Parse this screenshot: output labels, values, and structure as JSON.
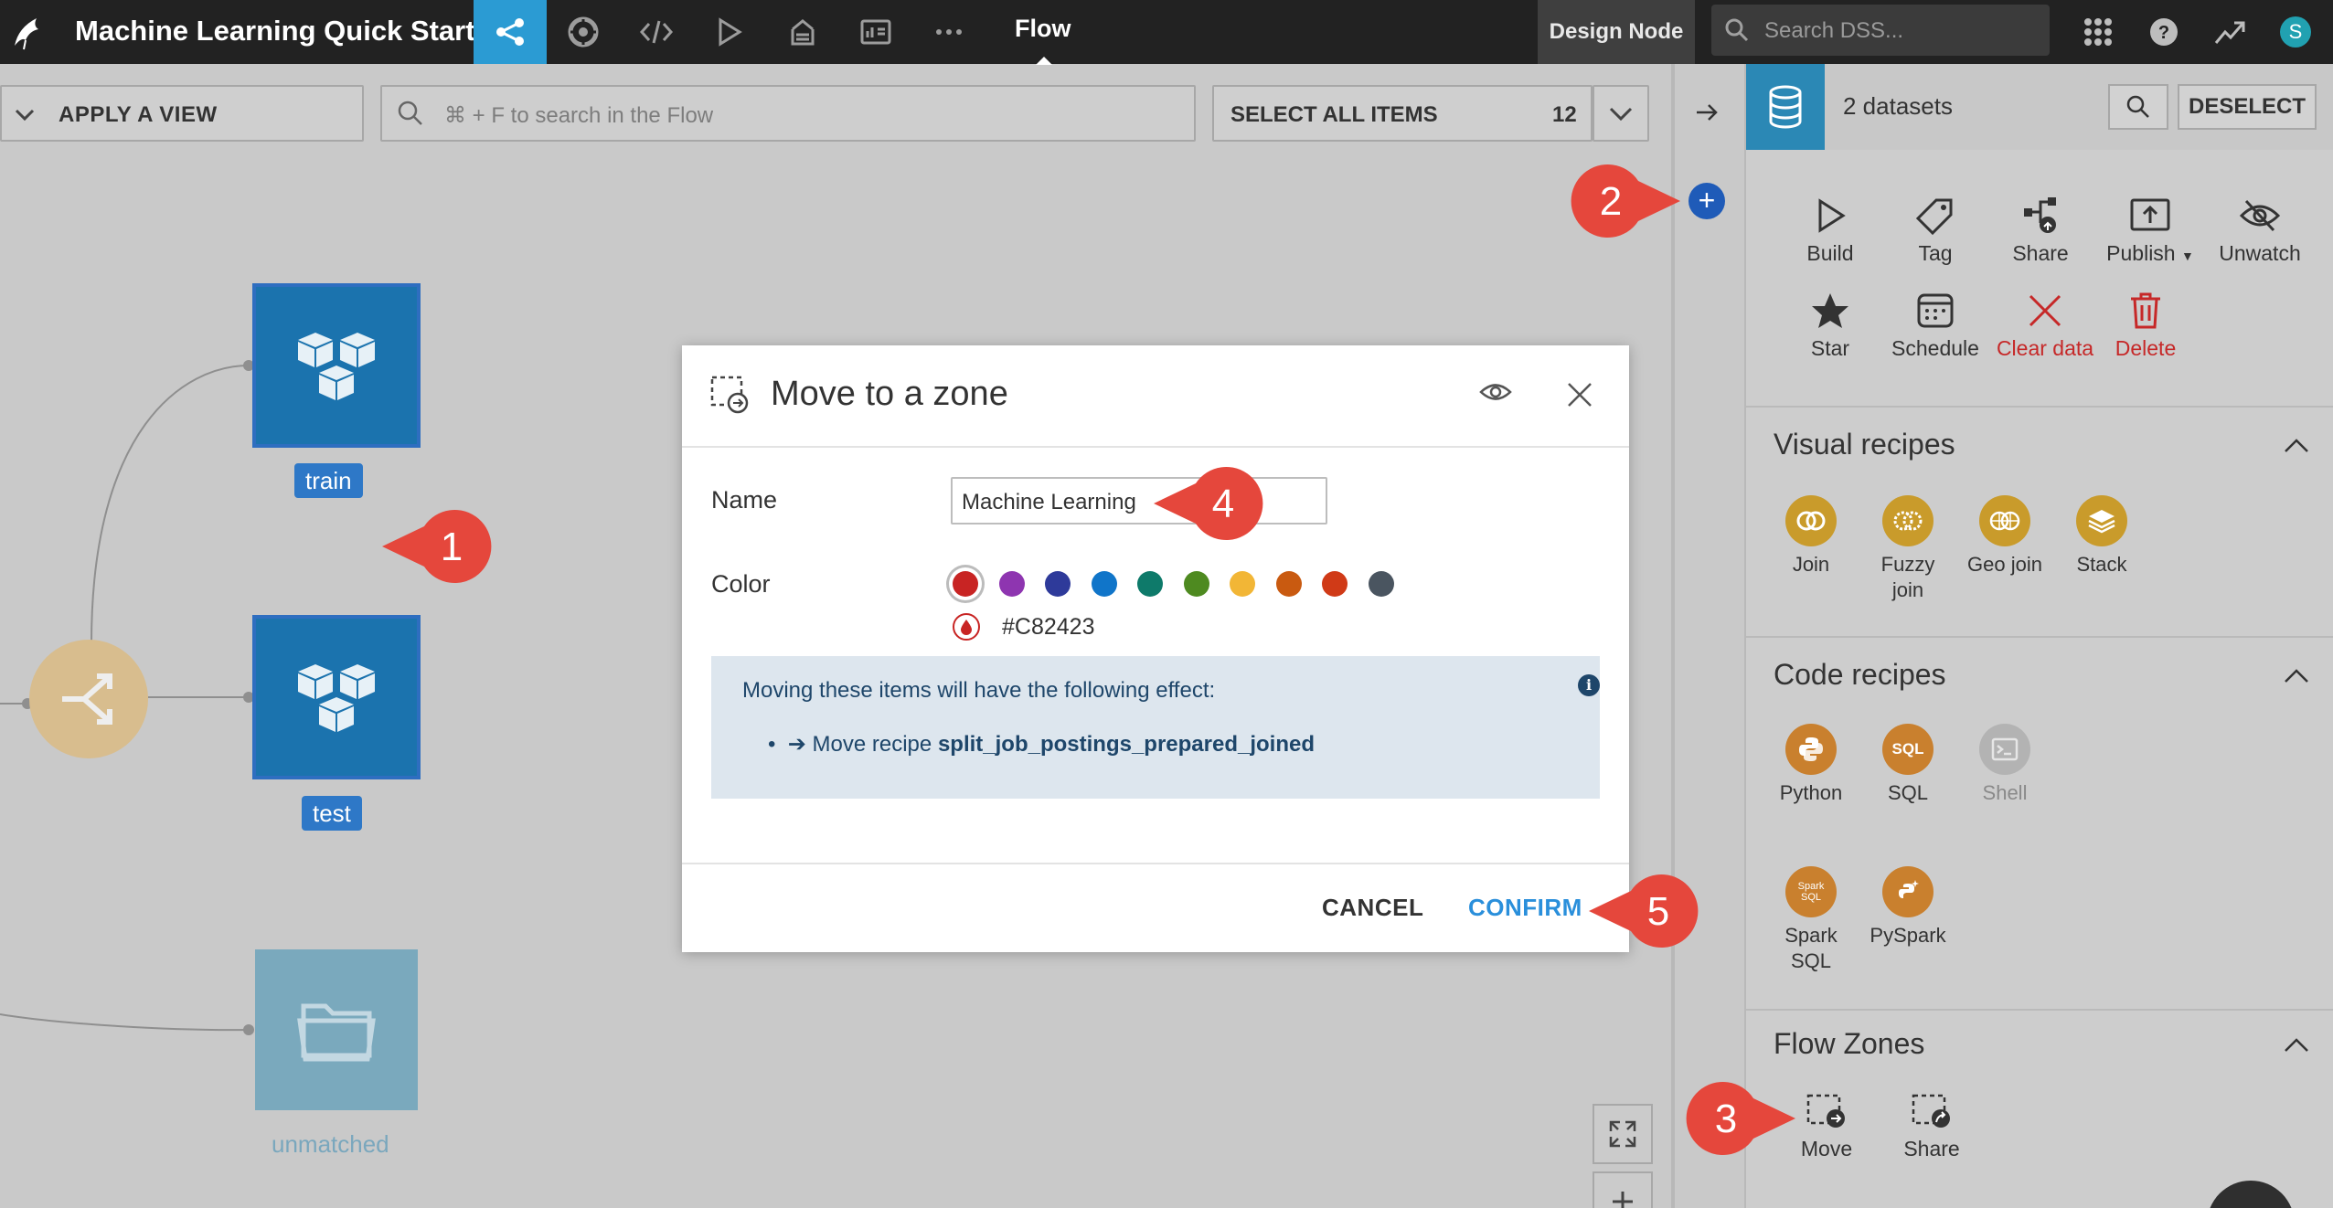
{
  "topbar": {
    "project_title": "Machine Learning Quick Start",
    "page_name": "Flow",
    "node_label": "Design Node",
    "search_placeholder": "Search DSS...",
    "avatar_initial": "S"
  },
  "flow_toolbar": {
    "apply_view_label": "APPLY A VIEW",
    "search_placeholder": "⌘ + F to search in the Flow",
    "select_all_label": "SELECT ALL ITEMS",
    "select_all_count": "12"
  },
  "flow_canvas": {
    "datasets": [
      {
        "label": "train"
      },
      {
        "label": "test"
      }
    ],
    "folder_label": "unmatched"
  },
  "callouts": [
    "1",
    "2",
    "3",
    "4",
    "5"
  ],
  "right_panel": {
    "selection_count": "2 datasets",
    "deselect_label": "DESELECT",
    "actions": [
      {
        "label": "Build",
        "icon": "play-icon"
      },
      {
        "label": "Tag",
        "icon": "tag-icon"
      },
      {
        "label": "Share",
        "icon": "share-icon"
      },
      {
        "label": "Publish",
        "icon": "publish-icon"
      },
      {
        "label": "Unwatch",
        "icon": "eye-off-icon"
      },
      {
        "label": "Star",
        "icon": "star-icon"
      },
      {
        "label": "Schedule",
        "icon": "calendar-icon"
      },
      {
        "label": "Clear data",
        "icon": "x-icon"
      },
      {
        "label": "Delete",
        "icon": "trash-icon"
      }
    ],
    "visual_recipes_title": "Visual recipes",
    "visual_recipes": [
      {
        "label": "Join"
      },
      {
        "label": "Fuzzy join"
      },
      {
        "label": "Geo join"
      },
      {
        "label": "Stack"
      }
    ],
    "code_recipes_title": "Code recipes",
    "code_recipes": [
      {
        "label": "Python",
        "glyph": ""
      },
      {
        "label": "SQL",
        "glyph": "SQL"
      },
      {
        "label": "Shell",
        "glyph": ""
      },
      {
        "label": "Spark SQL",
        "glyph": "Spark SQL"
      },
      {
        "label": "PySpark",
        "glyph": ""
      }
    ],
    "flow_zones_title": "Flow Zones",
    "flow_zone_actions": [
      {
        "label": "Move"
      },
      {
        "label": "Share"
      }
    ]
  },
  "modal": {
    "title": "Move to a zone",
    "name_label": "Name",
    "name_value": "Machine Learning",
    "color_label": "Color",
    "colors": [
      "#C82423",
      "#8E35B0",
      "#2E3A9A",
      "#1075C9",
      "#0E7A6A",
      "#4E8A20",
      "#F2B636",
      "#C95A10",
      "#D03A17",
      "#4A5560"
    ],
    "selected_color": "#C82423",
    "info_text": "Moving these items will have the following effect:",
    "effect_prefix": "Move recipe",
    "effect_recipe": "split_job_postings_prepared_joined",
    "cancel_label": "CANCEL",
    "confirm_label": "CONFIRM"
  }
}
